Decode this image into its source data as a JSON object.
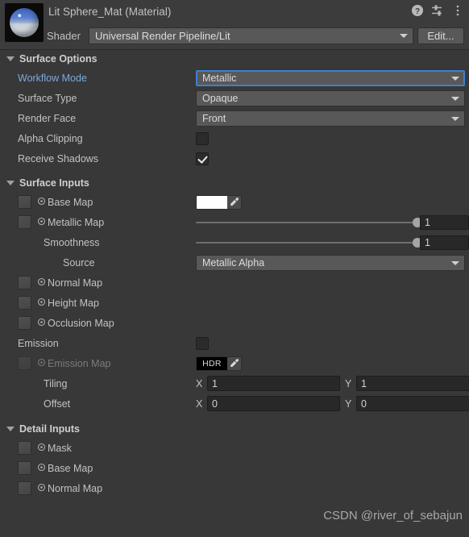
{
  "header": {
    "title": "Lit Sphere_Mat (Material)",
    "preview_icon": "material-sphere-preview",
    "icons": [
      {
        "name": "help-icon",
        "glyph": "?"
      },
      {
        "name": "preset-icon",
        "glyph": "presets"
      },
      {
        "name": "more-menu-icon",
        "glyph": "⋮"
      }
    ],
    "shader_label": "Shader",
    "shader_value": "Universal Render Pipeline/Lit",
    "edit_label": "Edit..."
  },
  "sections": {
    "surface_options": {
      "title": "Surface Options",
      "rows": {
        "workflow_mode": {
          "label": "Workflow Mode",
          "value": "Metallic"
        },
        "surface_type": {
          "label": "Surface Type",
          "value": "Opaque"
        },
        "render_face": {
          "label": "Render Face",
          "value": "Front"
        },
        "alpha_clipping": {
          "label": "Alpha Clipping",
          "checked": "false"
        },
        "receive_shadows": {
          "label": "Receive Shadows",
          "checked": "true"
        }
      }
    },
    "surface_inputs": {
      "title": "Surface Inputs",
      "rows": {
        "base_map": {
          "label": "Base Map",
          "color": "#ffffff"
        },
        "metallic_map": {
          "label": "Metallic Map",
          "value": "1",
          "slider_pct": "100"
        },
        "smoothness": {
          "label": "Smoothness",
          "value": "1",
          "slider_pct": "100"
        },
        "source": {
          "label": "Source",
          "value": "Metallic Alpha"
        },
        "normal_map": {
          "label": "Normal Map"
        },
        "height_map": {
          "label": "Height Map"
        },
        "occlusion_map": {
          "label": "Occlusion Map"
        },
        "emission": {
          "label": "Emission",
          "checked": "false"
        },
        "emission_map": {
          "label": "Emission Map",
          "badge": "HDR"
        },
        "tiling": {
          "label": "Tiling",
          "x_axis": "X",
          "x": "1",
          "y_axis": "Y",
          "y": "1"
        },
        "offset": {
          "label": "Offset",
          "x_axis": "X",
          "x": "0",
          "y_axis": "Y",
          "y": "0"
        }
      }
    },
    "detail_inputs": {
      "title": "Detail Inputs",
      "rows": {
        "mask": {
          "label": "Mask"
        },
        "base_map": {
          "label": "Base Map"
        },
        "normal_map": {
          "label": "Normal Map"
        }
      }
    }
  },
  "watermark": "CSDN @river_of_sebajun",
  "colors": {
    "background": "#383838",
    "header_bg": "#3c3c3c",
    "accent_blue": "#7aa8e0",
    "focus_blue": "#3f7fd1",
    "text": "#c2c2c2"
  }
}
